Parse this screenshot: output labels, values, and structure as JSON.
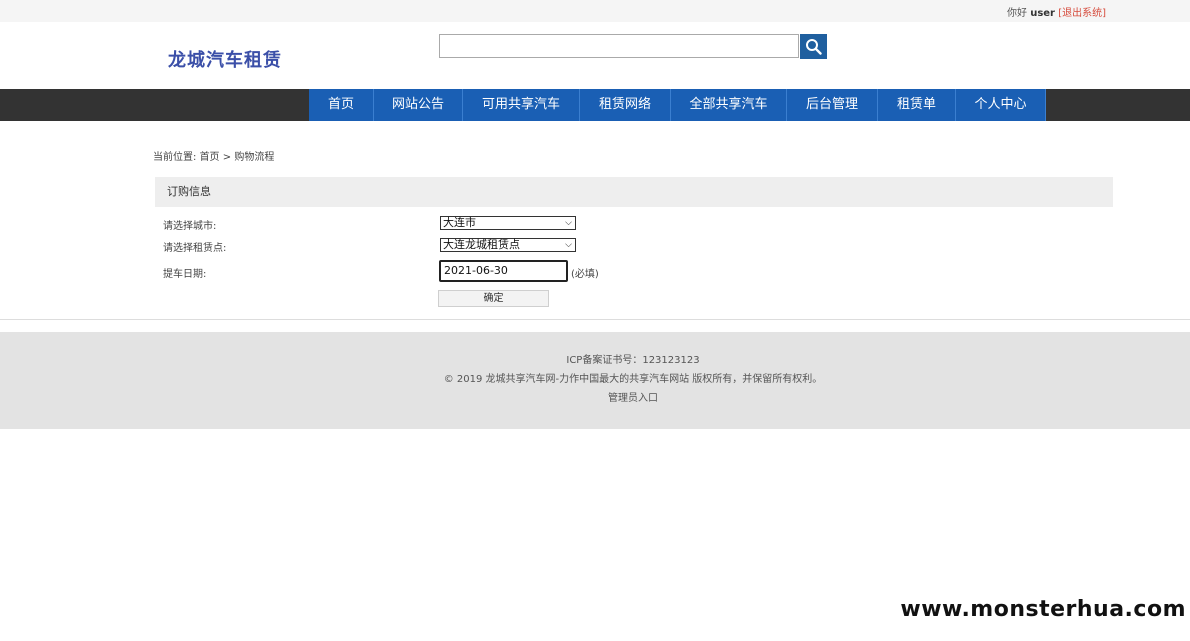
{
  "topbar": {
    "greeting": "你好",
    "username": "user",
    "logout": "[退出系统]"
  },
  "header": {
    "logo": "龙城汽车租赁",
    "search": {
      "value": "",
      "placeholder": ""
    }
  },
  "nav": {
    "items": [
      {
        "label": "首页"
      },
      {
        "label": "网站公告"
      },
      {
        "label": "可用共享汽车"
      },
      {
        "label": "租赁网络"
      },
      {
        "label": "全部共享汽车"
      },
      {
        "label": "后台管理"
      },
      {
        "label": "租赁单"
      },
      {
        "label": "个人中心"
      }
    ]
  },
  "breadcrumb": {
    "prefix": "当前位置:",
    "home": "首页",
    "separator": ">",
    "current": "购物流程"
  },
  "form": {
    "title": "订购信息",
    "city_label": "请选择城市:",
    "city_value": "大连市",
    "point_label": "请选择租赁点:",
    "point_value": "大连龙城租赁点",
    "date_label": "提车日期:",
    "date_value": "2021-06-30",
    "required_note": "(必填)",
    "confirm": "确定"
  },
  "footer": {
    "icp": "ICP备案证书号：123123123",
    "copyright": "© 2019 龙城共享汽车网-力作中国最大的共享汽车网站 版权所有，并保留所有权利。",
    "admin": "管理员入口"
  },
  "watermark": "www.monsterhua.com",
  "colors": {
    "nav_bg": "#333333",
    "nav_item": "#1a5fb4",
    "search_btn": "#1f5f9f",
    "logo": "#3b4fa8",
    "logout": "#d64b3c"
  },
  "icons": {
    "search": "search-icon",
    "dropdown": "chevron-down-icon"
  }
}
